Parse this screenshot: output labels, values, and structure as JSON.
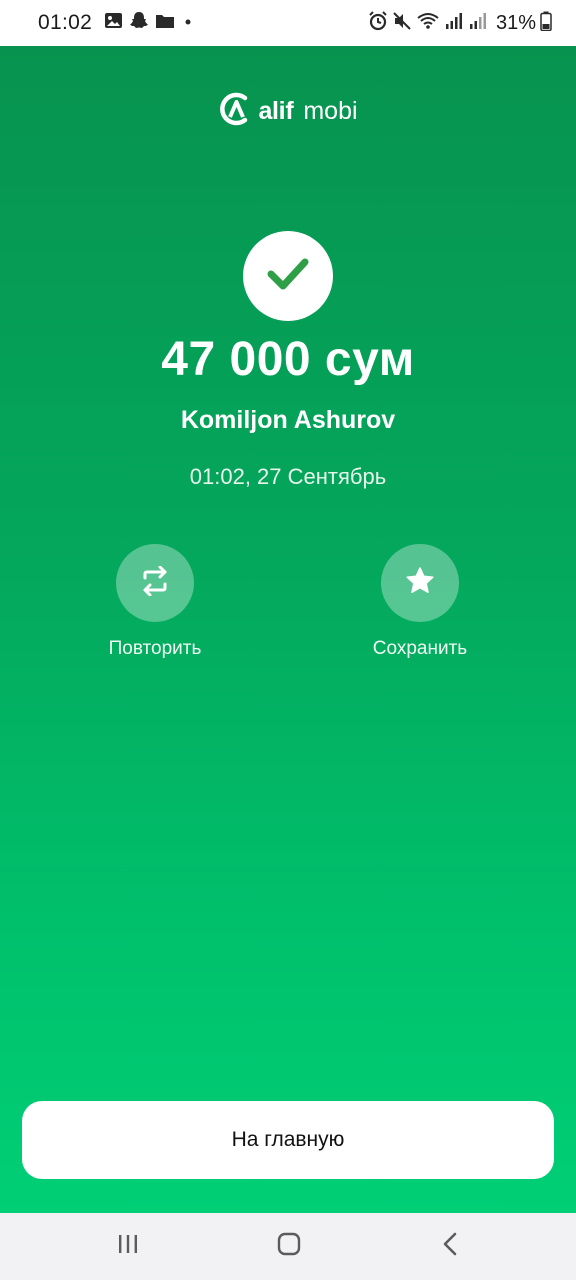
{
  "status_bar": {
    "time": "01:02",
    "battery": "31%",
    "left_icons": [
      "image-icon",
      "snapchat-icon",
      "folder-icon",
      "dot-icon"
    ],
    "right_icons": [
      "alarm-icon",
      "mute-icon",
      "wifi-icon",
      "signal-icon",
      "signal-icon",
      "battery-icon"
    ]
  },
  "logo": {
    "brand": "alif",
    "product": "mobi"
  },
  "transaction": {
    "status_icon": "check-icon",
    "amount": "47 000 сум",
    "recipient": "Komiljon Ashurov",
    "datetime": "01:02, 27 Сентябрь"
  },
  "actions": {
    "repeat": {
      "label": "Повторить",
      "icon": "repeat-icon"
    },
    "save": {
      "label": "Сохранить",
      "icon": "star-icon"
    }
  },
  "home_button": {
    "label": "На главную"
  },
  "nav_bar": {
    "recent": "recent-apps-icon",
    "home": "home-icon",
    "back": "back-icon"
  },
  "colors": {
    "gradient_top": "#07934f",
    "gradient_bottom": "#00cf76",
    "check": "#2e9e47"
  }
}
